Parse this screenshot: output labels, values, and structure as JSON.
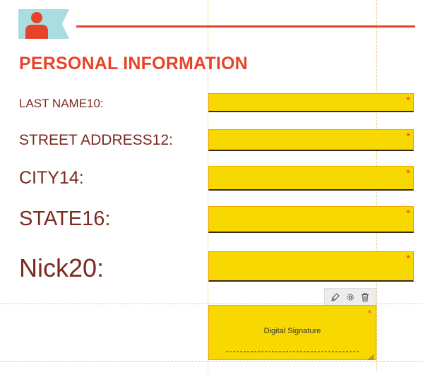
{
  "section": {
    "title": "PERSONAL INFORMATION"
  },
  "icons": {
    "header": "person-ribbon-icon",
    "required": "required-asterisk-icon",
    "toolbar": [
      "pen-icon",
      "gear-icon",
      "trash-icon"
    ],
    "resize": "resize-handle-icon"
  },
  "fields": [
    {
      "label": "LAST NAME10:",
      "required_mark": "*"
    },
    {
      "label": "STREET ADDRESS12:",
      "required_mark": "*"
    },
    {
      "label": "CITY14:",
      "required_mark": "*"
    },
    {
      "label": "STATE16:",
      "required_mark": "*"
    },
    {
      "label": "Nick20:",
      "required_mark": "*"
    }
  ],
  "signature": {
    "label": "Digital Signature",
    "required_mark": "*"
  },
  "colors": {
    "accent": "#e8432a",
    "label_text": "#7a2a21",
    "field_fill": "#f7d800",
    "field_border": "#f0a800",
    "icon_ribbon": "#a9dde0",
    "guide_lines": "#e2c44a"
  }
}
